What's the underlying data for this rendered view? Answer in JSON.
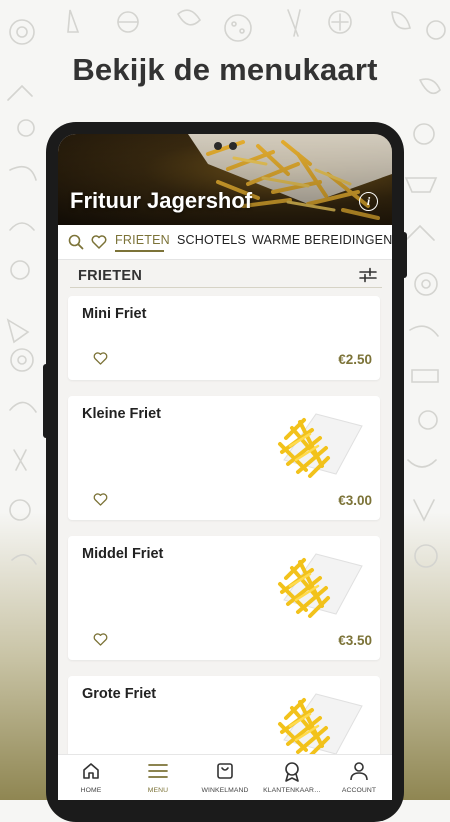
{
  "promo": {
    "headline": "Bekijk de menukaart"
  },
  "restaurant": {
    "name": "Frituur Jagershof"
  },
  "tabs": [
    {
      "label": "FRIETEN",
      "active": true
    },
    {
      "label": "SCHOTELS",
      "active": false
    },
    {
      "label": "WARME BEREIDINGEN",
      "active": false
    }
  ],
  "section": {
    "title": "FRIETEN"
  },
  "products": [
    {
      "name": "Mini Friet",
      "price": "€2.50",
      "has_image": false
    },
    {
      "name": "Kleine Friet",
      "price": "€3.00",
      "has_image": true
    },
    {
      "name": "Middel Friet",
      "price": "€3.50",
      "has_image": true
    },
    {
      "name": "Grote Friet",
      "price": "",
      "has_image": true
    }
  ],
  "bottom_nav": [
    {
      "label": "HOME",
      "icon": "home-icon",
      "active": false
    },
    {
      "label": "MENU",
      "icon": "menu-icon",
      "active": true
    },
    {
      "label": "WINKELMAND",
      "icon": "basket-icon",
      "active": false
    },
    {
      "label": "KLANTENKAAR…",
      "icon": "award-icon",
      "active": false
    },
    {
      "label": "ACCOUNT",
      "icon": "user-icon",
      "active": false
    }
  ],
  "colors": {
    "accent": "#7c7338",
    "hero_dark": "#1a1208"
  }
}
